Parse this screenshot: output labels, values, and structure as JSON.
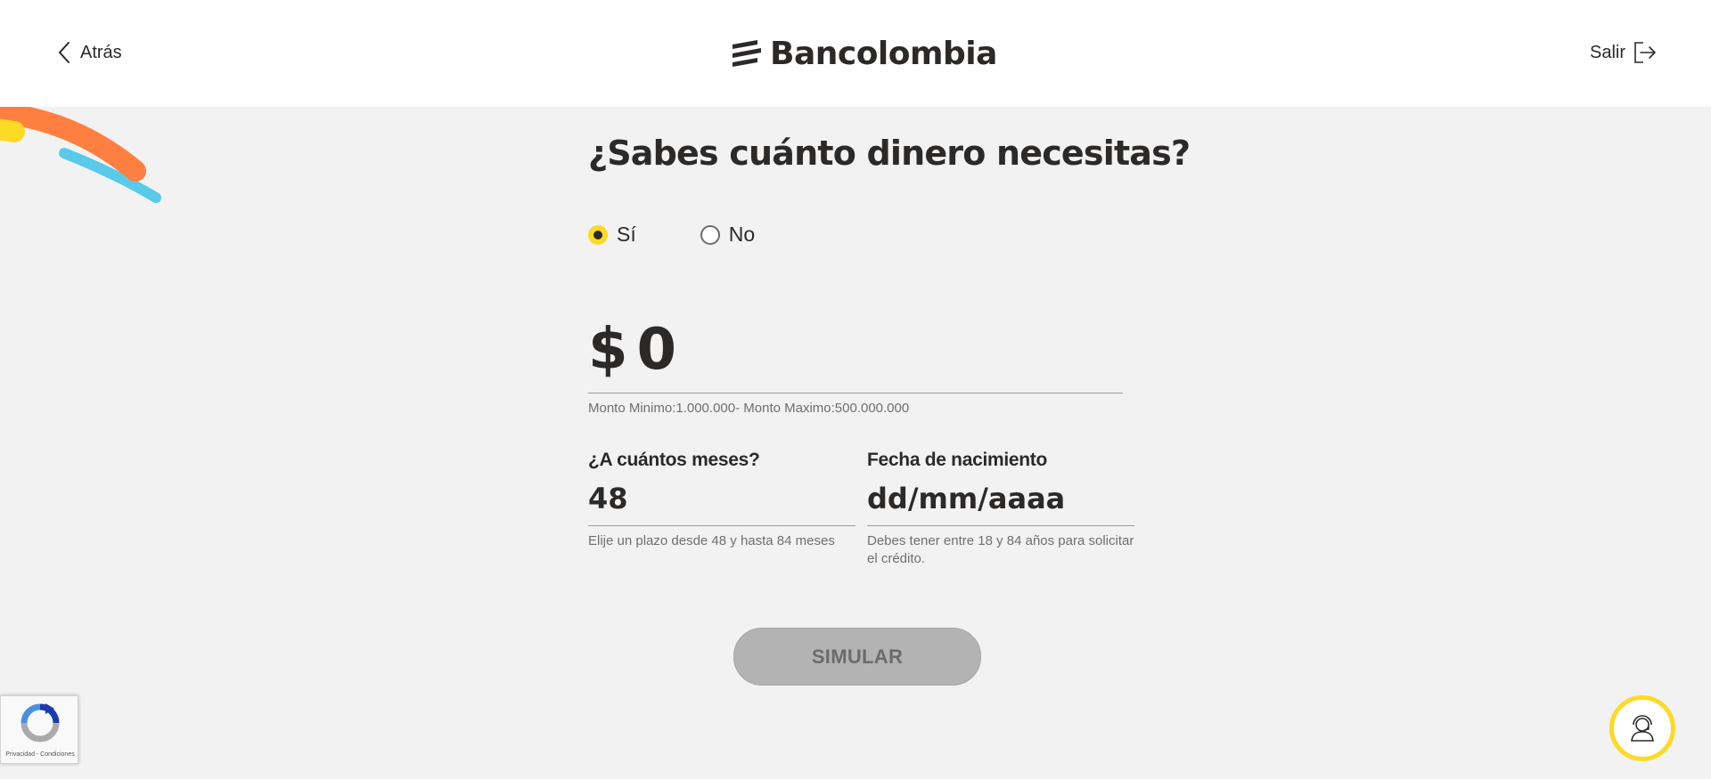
{
  "header": {
    "back_label": "Atrás",
    "brand_name": "Bancolombia",
    "exit_label": "Salir"
  },
  "form": {
    "title": "¿Sabes cuánto dinero necesitas?",
    "radio_yes_label": "Sí",
    "radio_no_label": "No",
    "radio_selected": "Sí",
    "amount_currency": "$",
    "amount_value": "0",
    "amount_hint": "Monto Minimo:1.000.000- Monto Maximo:500.000.000",
    "months_label": "¿A cuántos meses?",
    "months_value": "48",
    "months_hint": "Elije un plazo desde 48 y hasta 84 meses",
    "birth_label": "Fecha de nacimiento",
    "birth_placeholder": "dd/mm/aaaa",
    "birth_hint": "Debes tener entre 18 y 84 años para solicitar el crédito.",
    "simulate_label": "SIMULAR"
  },
  "recaptcha": {
    "footer_text": "Privacidad - Condiciones"
  },
  "icons": {
    "back": "chevron-left-icon",
    "exit": "logout-icon",
    "help": "support-agent-icon",
    "recaptcha": "recaptcha-logo"
  },
  "colors": {
    "accent_yellow": "#fdda24",
    "text_dark": "#2c2a29",
    "background": "#f2f2f2",
    "button_disabled": "#b3b3b3",
    "deco_orange": "#ff7f41",
    "deco_blue": "#59cbe8"
  }
}
